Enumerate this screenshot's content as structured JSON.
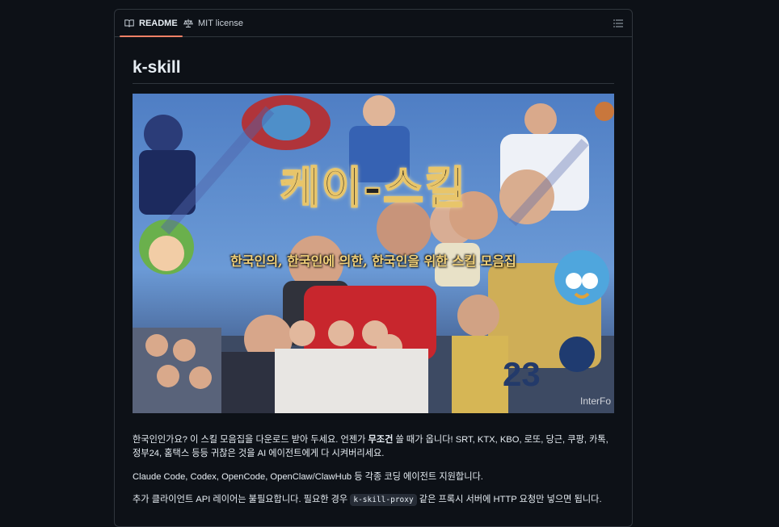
{
  "tabs": {
    "readme": "README",
    "license": "MIT license"
  },
  "readme": {
    "title": "k-skill",
    "hero": {
      "title": "케이-스킬",
      "subtitle": "한국인의, 한국인에 의한, 한국인을 위한 스킬 모음집",
      "watermark": "InterFo",
      "jersey_number": "23"
    },
    "para1": {
      "before": "한국인인가요? 이 스킬 모음집을 다운로드 받아 두세요. 언젠가 ",
      "strong": "무조건",
      "after": " 쓸 때가 옵니다! SRT, KTX, KBO, 로또, 당근, 쿠팡, 카톡,",
      "line2": "정부24, 홈택스 등등 귀찮은 것을 AI 에이전트에게 다 시켜버리세요."
    },
    "para2": "Claude Code, Codex, OpenCode, OpenClaw/ClawHub 등 각종 코딩 에이전트 지원합니다.",
    "para3": {
      "before": "추가 클라이언트 API 레이어는 불필요합니다. 필요한 경우 ",
      "code": "k-skill-proxy",
      "after": " 같은 프록시 서버에 HTTP 요청만 넣으면 됩니다."
    }
  },
  "colors": {
    "background": "#0d1117",
    "border": "#30363d",
    "text": "#e6edf3",
    "active_tab_underline": "#f78166"
  }
}
